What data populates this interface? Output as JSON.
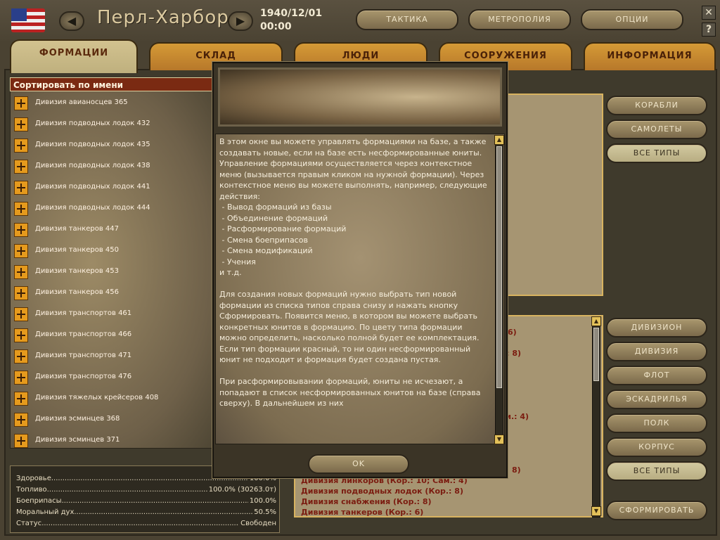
{
  "header": {
    "title": "Перл-Харбор",
    "date": "1940/12/01",
    "time": "00:00",
    "buttons": [
      "ТАКТИКА",
      "МЕТРОПОЛИЯ",
      "ОПЦИИ"
    ],
    "close_glyph": "✕",
    "help_glyph": "?"
  },
  "tabs": [
    "ФОРМАЦИИ",
    "СКЛАД",
    "ЛЮДИ",
    "СООРУЖЕНИЯ",
    "ИНФОРМАЦИЯ"
  ],
  "list": {
    "sort_label": "Сортировать по имени",
    "items": [
      "Дивизия авианосцев 365",
      "Дивизия подводных лодок 432",
      "Дивизия подводных лодок 435",
      "Дивизия подводных лодок 438",
      "Дивизия подводных лодок 441",
      "Дивизия подводных лодок 444",
      "Дивизия танкеров 447",
      "Дивизия танкеров 450",
      "Дивизия танкеров 453",
      "Дивизия танкеров 456",
      "Дивизия транспортов 461",
      "Дивизия транспортов 466",
      "Дивизия транспортов 471",
      "Дивизия транспортов 476",
      "Дивизия тяжелых крейсеров 408",
      "Дивизия эсминцев 368",
      "Дивизия эсминцев 371"
    ]
  },
  "stats": [
    {
      "label": "Здоровье",
      "value": "100.0%"
    },
    {
      "label": "Топливо",
      "value": "100.0% (30263.0т)"
    },
    {
      "label": "Боеприпасы",
      "value": "100.0%"
    },
    {
      "label": "Моральный дух",
      "value": "50.5%"
    },
    {
      "label": "Статус",
      "value": "Свободен"
    }
  ],
  "right": {
    "filter_buttons": [
      "КОРАБЛИ",
      "САМОЛЕТЫ",
      "ВСЕ ТИПЫ"
    ],
    "type_buttons": [
      "ДИВИЗИОН",
      "ДИВИЗИЯ",
      "ФЛОТ",
      "ЭСКАДРИЛЬЯ",
      "ПОЛК",
      "КОРПУС",
      "ВСЕ ТИПЫ"
    ],
    "form_button": "СФОРМИРОВАТЬ",
    "partial_lines": [
      "6)",
      ".: 8)",
      "м.: 4)",
      "8)"
    ],
    "type_list": [
      "Дивизия линкоров (Кор.: 10; Сам.: 4)",
      "Дивизия подводных лодок (Кор.: 8)",
      "Дивизия снабжения (Кор.: 8)",
      "Дивизия танкеров (Кор.: 6)"
    ]
  },
  "dialog": {
    "text": "В этом окне вы можете управлять формациями на базе, а также создавать новые, если на базе есть несформированные юниты.\nУправление формациями осуществляется через контекстное меню (вызывается правым кликом на нужной формации). Через контекстное меню вы можете выполнять, например, следующие действия:\n - Вывод формаций из базы\n - Объединение формаций\n - Расформирование формаций\n - Смена боеприпасов\n - Смена модификаций\n - Учения\nи т.д.\n\nДля создания новых формаций нужно выбрать тип новой формации из списка типов справа снизу и нажать кнопку Сформировать. Появится меню, в котором вы можете выбрать конкретных юнитов в формацию. По цвету типа формации можно определить, насколько полной будет ее комплектация. Если тип формации красный, то ни один несформированный юнит не подходит и формация будет создана пустая.\n\nПри расформировывании формаций, юниты не исчезают, а попадают в список несформированных юнитов на базе (справа сверху). В дальнейшем из них",
    "ok_label": "OK"
  },
  "colors": {
    "tab_orange": "#d59a36",
    "tab_active": "#d2c28f",
    "list_header": "#7a2a12",
    "plus_icon": "#e59a1d",
    "red_text": "#7b1c10"
  }
}
